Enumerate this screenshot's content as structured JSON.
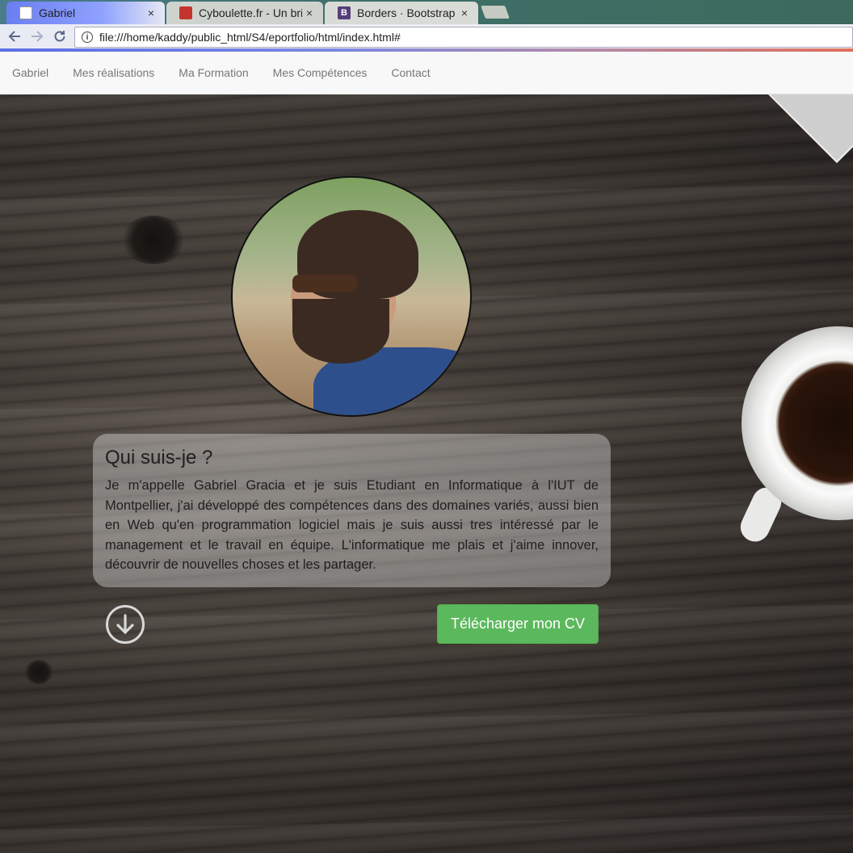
{
  "browser": {
    "tabs": [
      {
        "title": "Gabriel",
        "active": true
      },
      {
        "title": "Cyboulette.fr - Un bri",
        "active": false
      },
      {
        "title": "Borders · Bootstrap",
        "active": false
      }
    ],
    "close_glyph": "×",
    "url": "file:///home/kaddy/public_html/S4/eportfolio/html/index.html#",
    "icons": {
      "back": "back-arrow-icon",
      "forward": "forward-arrow-icon",
      "reload": "reload-icon",
      "info": "info-icon"
    }
  },
  "navbar": {
    "brand": "Gabriel",
    "links": [
      "Mes réalisations",
      "Ma Formation",
      "Mes Compétences",
      "Contact"
    ]
  },
  "about": {
    "heading": "Qui suis-je ?",
    "text": "Je m'appelle Gabriel Gracia et je suis Etudiant en Informatique à l'IUT de Montpellier, j'ai développé des compétences dans des domaines variés, aussi bien en Web qu'en programmation logiciel mais je suis aussi tres intéressé par le management et le travail en équipe. L'informatique me plais et j'aime innover, découvrir de nouvelles choses et les partager."
  },
  "actions": {
    "scroll_icon": "arrow-down-circle-icon",
    "cv_button": "Télécharger mon CV"
  },
  "colors": {
    "cv_button": "#5cb85c",
    "navbar_bg": "#f8f8f8",
    "nav_link": "#777777"
  }
}
